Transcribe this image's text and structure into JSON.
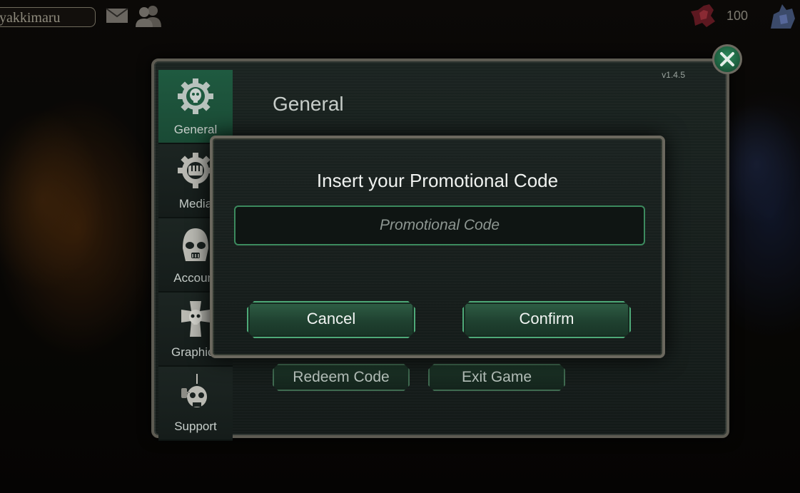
{
  "hud": {
    "player_name": "yakkimaru",
    "currency_count": "100",
    "icons": [
      "mail-icon",
      "friends-icon",
      "red-crest-icon",
      "blue-unit-icon"
    ]
  },
  "settings": {
    "version": "v1.4.5",
    "section_title": "General",
    "sidebar": [
      {
        "label": "General",
        "icon": "cog-skull-icon",
        "active": true
      },
      {
        "label": "Media",
        "icon": "cog-fist-icon",
        "active": false
      },
      {
        "label": "Account",
        "icon": "helmet-icon",
        "active": false
      },
      {
        "label": "Graphics",
        "icon": "cross-skull-icon",
        "active": false
      },
      {
        "label": "Support",
        "icon": "servo-skull-icon",
        "active": false
      }
    ],
    "buttons": {
      "redeem": "Redeem Code",
      "exit": "Exit Game"
    }
  },
  "modal": {
    "title": "Insert your Promotional Code",
    "input_placeholder": "Promotional Code",
    "input_value": "",
    "cancel_label": "Cancel",
    "confirm_label": "Confirm"
  },
  "colors": {
    "accent_green": "#4ea978",
    "active_tab": "#1f5a40",
    "frame": "#6b685e"
  }
}
